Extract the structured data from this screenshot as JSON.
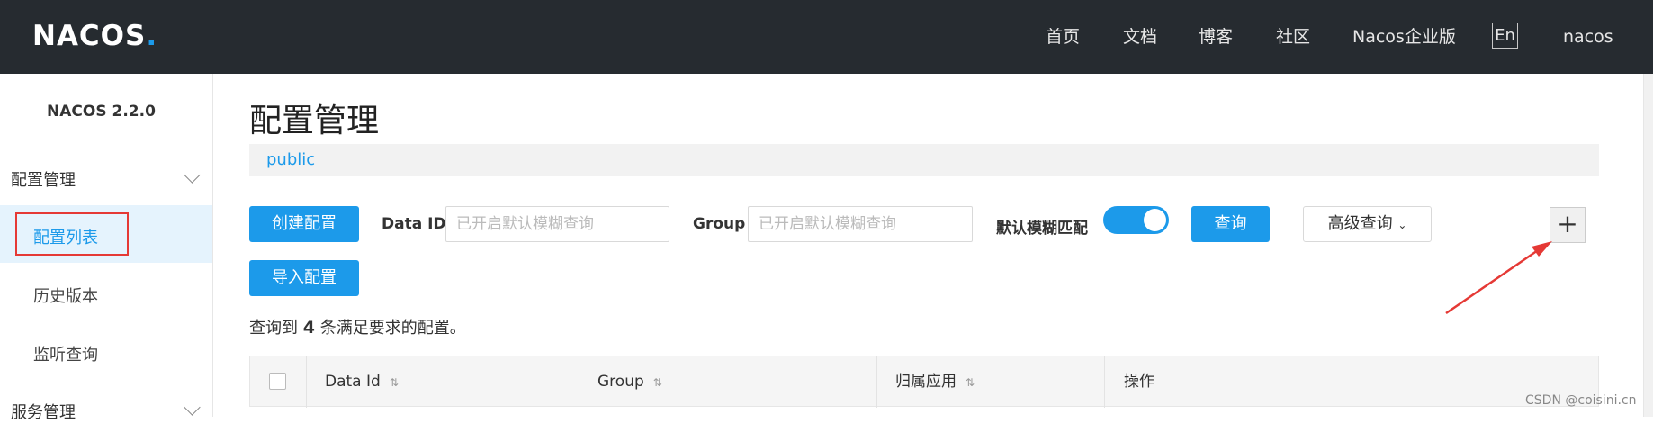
{
  "header": {
    "logo_text": "NACOS",
    "logo_dot": ".",
    "nav": [
      "首页",
      "文档",
      "博客",
      "社区",
      "Nacos企业版"
    ],
    "lang": "En",
    "user": "nacos"
  },
  "sidebar": {
    "version": "NACOS 2.2.0",
    "group1": "配置管理",
    "items": [
      "配置列表",
      "历史版本",
      "监听查询"
    ],
    "group2": "服务管理"
  },
  "main": {
    "title": "配置管理",
    "namespace": "public",
    "create_button": "创建配置",
    "import_button": "导入配置",
    "dataid_label": "Data ID",
    "dataid_placeholder": "已开启默认模糊查询",
    "group_label": "Group",
    "group_placeholder": "已开启默认模糊查询",
    "fuzzy_label": "默认模糊匹配",
    "fuzzy_enabled": true,
    "search_button": "查询",
    "advanced_button": "高级查询",
    "add_button": "+",
    "result_prefix": "查询到",
    "result_count": "4",
    "result_suffix": "条满足要求的配置。"
  },
  "table": {
    "columns": [
      "Data Id",
      "Group",
      "归属应用",
      "操作"
    ]
  },
  "watermark": "CSDN @coisini.cn",
  "colors": {
    "topbar": "#262b30",
    "primary": "#1c9aea",
    "annotation": "#e53935"
  }
}
